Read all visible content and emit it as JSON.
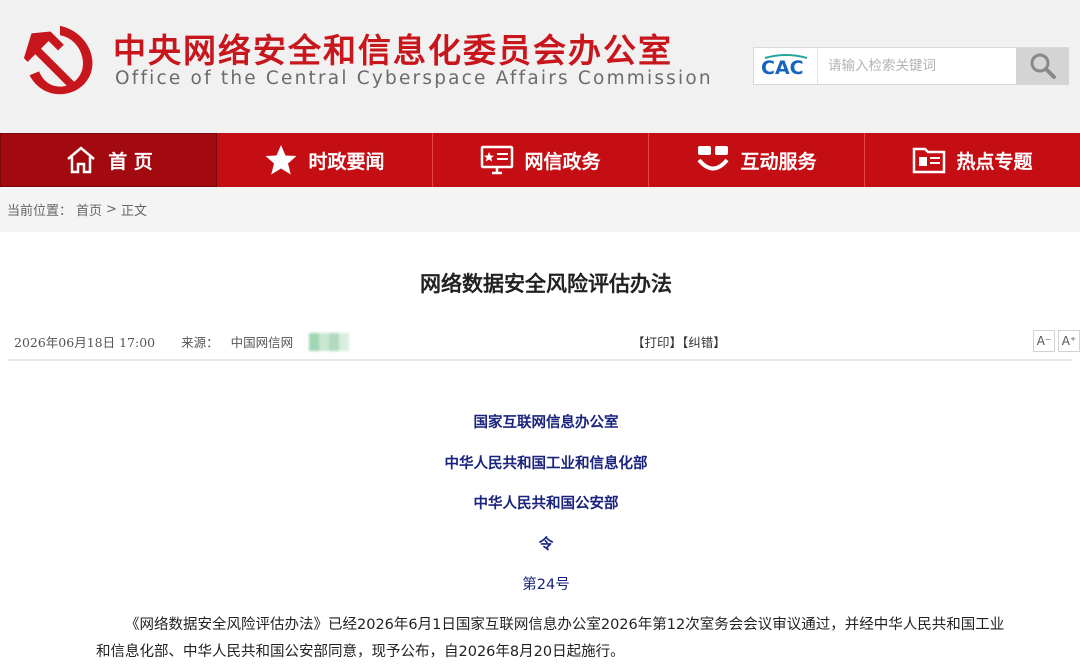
{
  "header": {
    "site_title": "中央网络安全和信息化委员会办公室",
    "site_subtitle": "Office of the Central Cyberspace Affairs Commission",
    "cac_logo_text": "CAC",
    "search_placeholder": "请输入检索关键词"
  },
  "nav": {
    "items": [
      {
        "label": "首 页",
        "icon": "home-icon"
      },
      {
        "label": "时政要闻",
        "icon": "star-icon"
      },
      {
        "label": "网信政务",
        "icon": "monitor-icon"
      },
      {
        "label": "互动服务",
        "icon": "chat-icon"
      },
      {
        "label": "热点专题",
        "icon": "folder-icon"
      }
    ],
    "active_index": 0
  },
  "breadcrumb": {
    "prefix": "当前位置：",
    "home": "首页",
    "separator": ">",
    "current": "正文"
  },
  "article": {
    "title": "网络数据安全风险评估办法",
    "date": "2026年06月18日  17:00",
    "source_label": "来源：",
    "source": "中国网信网",
    "print_label": "【打印】",
    "correct_label": "【纠错】",
    "font_smaller": "A⁻",
    "font_larger": "A⁺",
    "issuers": [
      "国家互联网信息办公室",
      "中华人民共和国工业和信息化部",
      "中华人民共和国公安部"
    ],
    "order_label": "令",
    "order_number": "第24号",
    "body": "《网络数据安全风险评估办法》已经2026年6月1日国家互联网信息办公室2026年第12次室务会会议审议通过，并经中华人民共和国工业和信息化部、中华人民共和国公安部同意，现予公布，自2026年8月20日起施行。"
  },
  "colors": {
    "brand_red": "#c40e14",
    "issuer_navy": "#1a237e"
  }
}
